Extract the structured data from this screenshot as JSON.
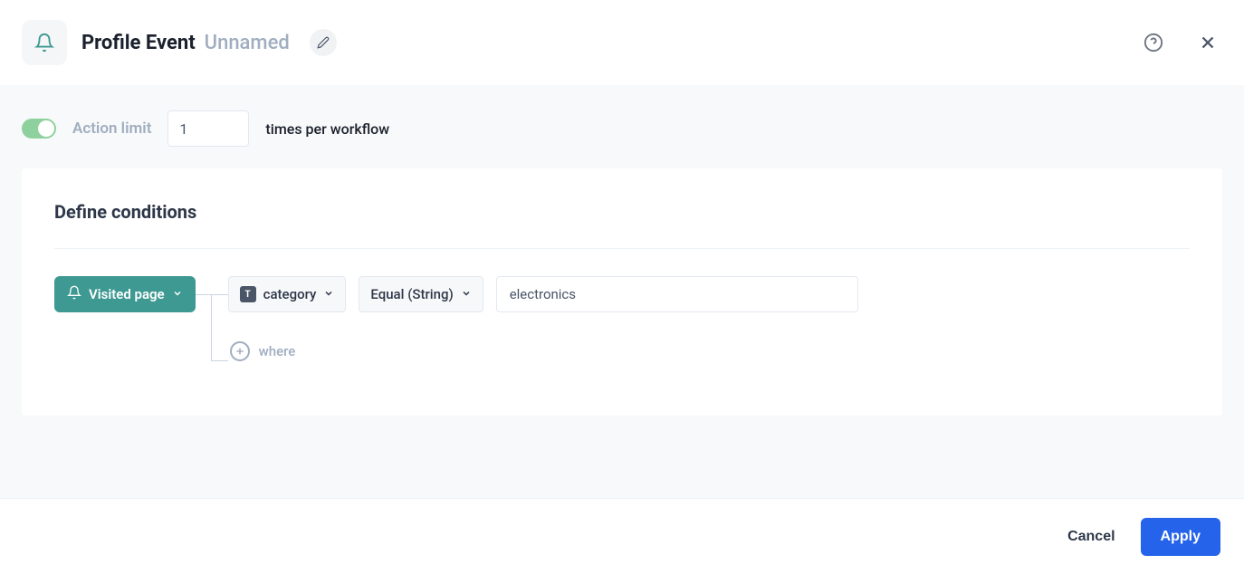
{
  "header": {
    "title": "Profile Event",
    "subtitle": "Unnamed"
  },
  "actionLimit": {
    "label": "Action limit",
    "value": "1",
    "suffix": "times per workflow"
  },
  "card": {
    "title": "Define conditions",
    "event": {
      "label": "Visited page"
    },
    "condition": {
      "attribute": "category",
      "operator": "Equal (String)",
      "value": "electronics"
    },
    "addWhere": "where"
  },
  "footer": {
    "cancel": "Cancel",
    "apply": "Apply"
  }
}
